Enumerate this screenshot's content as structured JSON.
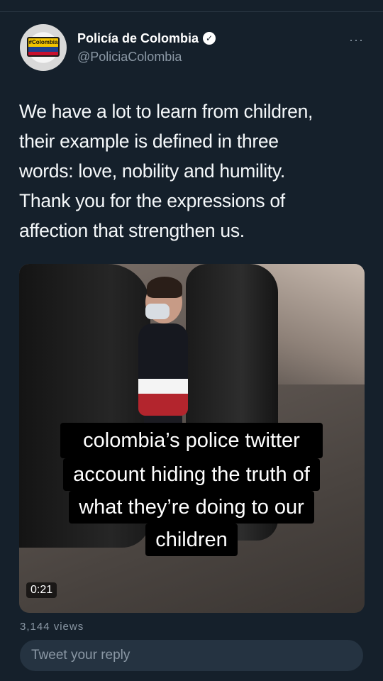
{
  "tweet": {
    "author_name": "Policía de Colombia",
    "author_handle": "@PoliciaColombia",
    "verified": true,
    "avatar_text": "#Colombia",
    "more_icon": "more-horizontal-icon",
    "text_lines": [
      "We have a lot to learn from children,",
      "their example is defined in three",
      "words: love, nobility and humility.",
      "Thank you for the expressions of",
      "affection that strengthen us."
    ],
    "video_duration": "0:21",
    "views": "3,144 views"
  },
  "overlay_caption": {
    "lines": [
      "colombia’s police twitter",
      "account hiding the truth of",
      "what they’re doing to our",
      "children"
    ]
  },
  "reply": {
    "placeholder": "Tweet your reply"
  },
  "colors": {
    "background": "#15202b",
    "secondary_text": "#8b98a5",
    "reply_bar": "#253341"
  }
}
